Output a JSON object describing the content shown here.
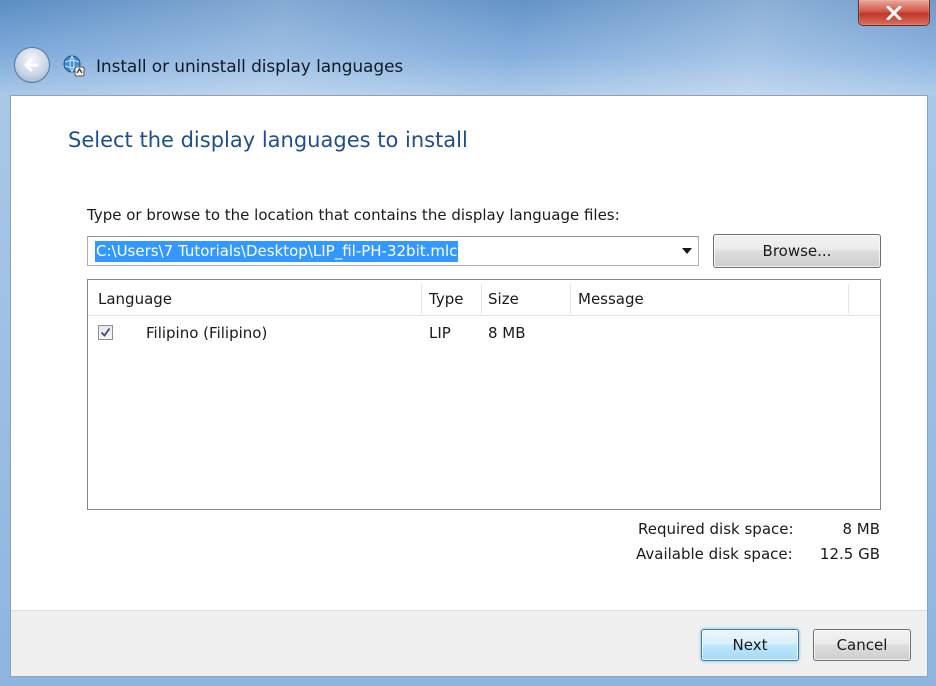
{
  "window": {
    "title": "Install or uninstall display languages",
    "close_icon": "close-icon",
    "back_icon": "back-arrow-icon",
    "app_icon": "language-globe-icon"
  },
  "page": {
    "heading": "Select the display languages to install",
    "prompt": "Type or browse to the location that contains the display language files:",
    "path_value": "C:\\Users\\7 Tutorials\\Desktop\\LIP_fil-PH-32bit.mlc",
    "browse_label": "Browse..."
  },
  "list": {
    "columns": [
      "Language",
      "Type",
      "Size",
      "Message"
    ],
    "rows": [
      {
        "checked": true,
        "language": "Filipino (Filipino)",
        "type": "LIP",
        "size": "8 MB",
        "message": ""
      }
    ]
  },
  "disk": {
    "required_label": "Required disk space:",
    "required_value": "8 MB",
    "available_label": "Available disk space:",
    "available_value": "12.5 GB"
  },
  "footer": {
    "next_label": "Next",
    "cancel_label": "Cancel"
  },
  "colors": {
    "accent_heading": "#1e4e8c",
    "selection": "#3399ff",
    "close_button": "#c0372a"
  }
}
